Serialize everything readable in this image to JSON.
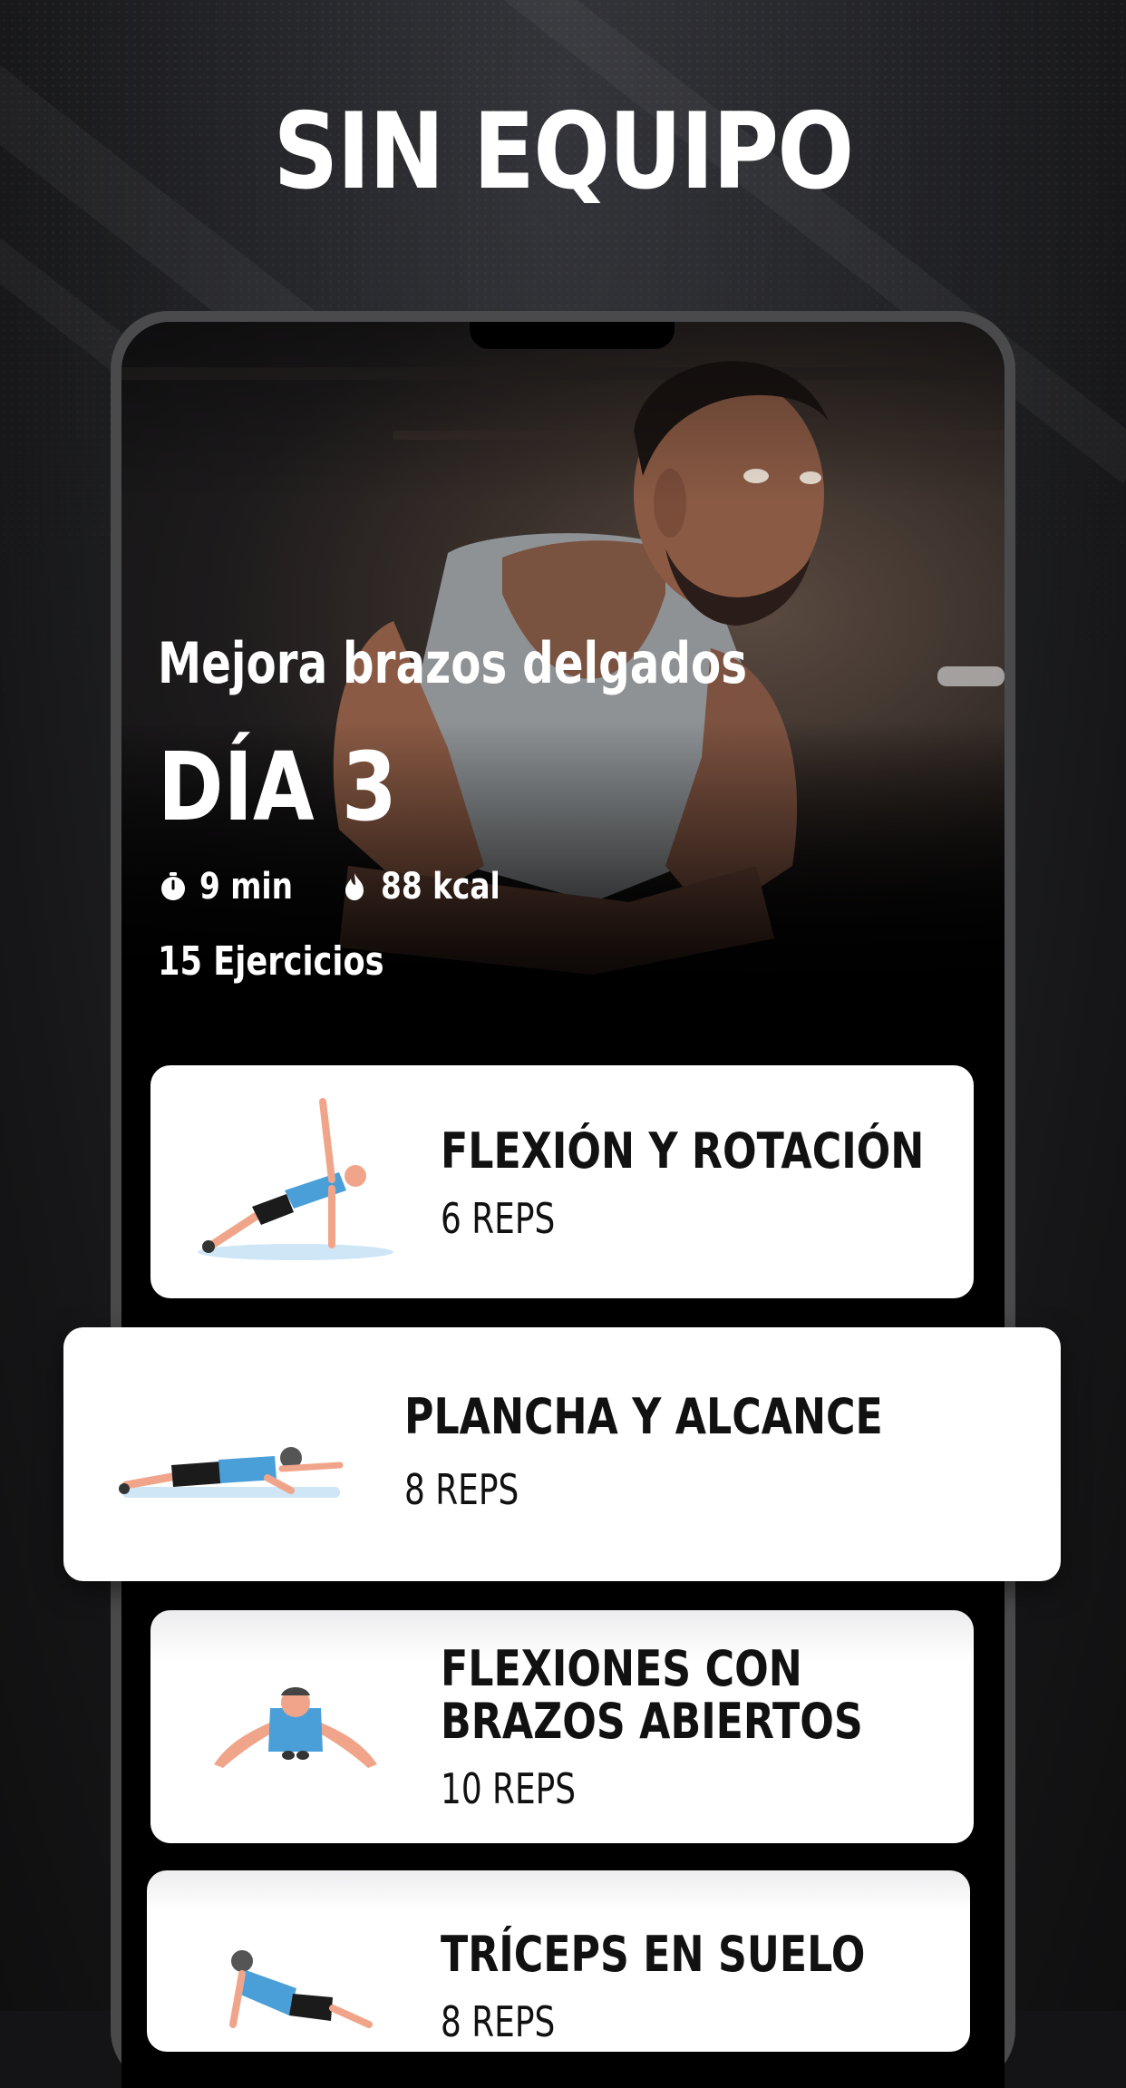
{
  "headline": "SIN EQUIPO",
  "hero": {
    "title": "Mejora brazos delgados",
    "day": "DÍA 3",
    "duration": "9 min",
    "calories": "88 kcal",
    "exercise_count": "15 Ejercicios"
  },
  "icons": {
    "timer": "stopwatch-icon",
    "calories": "flame-icon"
  },
  "exercises": [
    {
      "name": "FLEXIÓN Y ROTACIÓN",
      "reps": "6 REPS"
    },
    {
      "name": "PLANCHA Y ALCANCE",
      "reps": "8 REPS"
    },
    {
      "name_line1": "FLEXIONES CON",
      "name_line2": "BRAZOS ABIERTOS",
      "reps": "10 REPS"
    },
    {
      "name": "TRÍCEPS EN SUELO",
      "reps": "8 REPS"
    }
  ],
  "colors": {
    "accent_shirt": "#4a9fd8",
    "mat": "#cfe6f7",
    "skin": "#f0a58a"
  }
}
